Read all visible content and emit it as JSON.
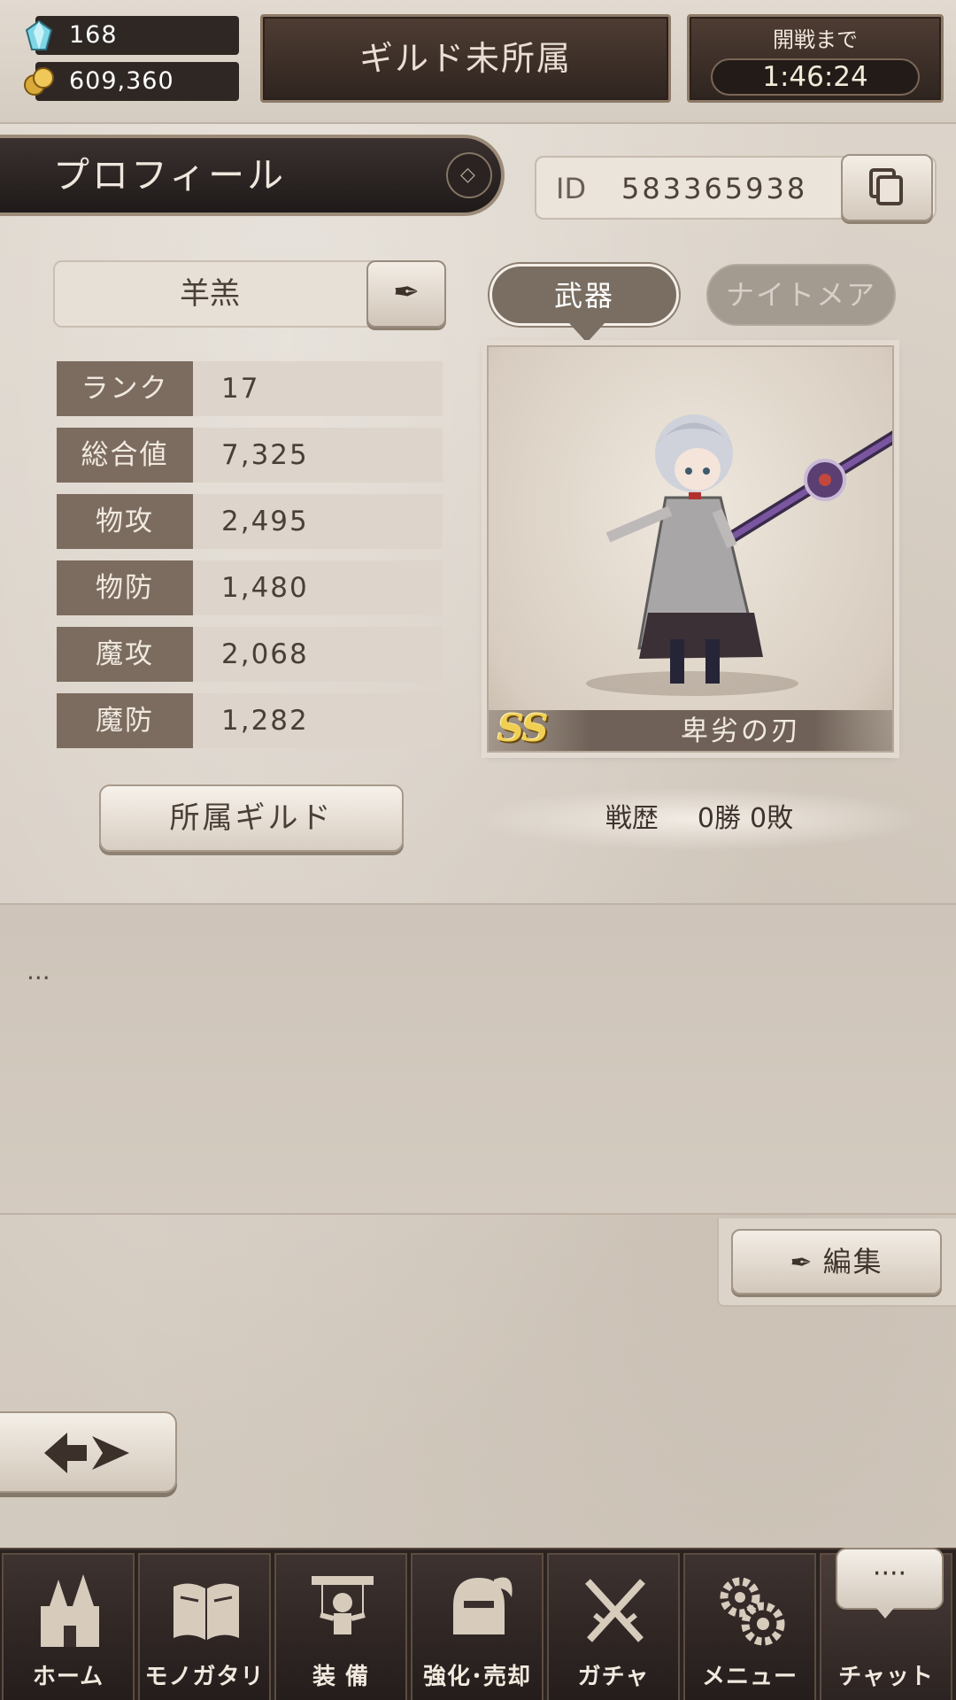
{
  "header": {
    "gems": "168",
    "gold": "609,360",
    "guild_status": "ギルド未所属",
    "battle_label": "開戦まで",
    "battle_timer": "1:46:24"
  },
  "profile": {
    "title": "プロフィール",
    "id_label": "ID",
    "id_value": "583365938",
    "name": "羊羔",
    "stats": [
      {
        "label": "ランク",
        "value": "17"
      },
      {
        "label": "総合値",
        "value": "7,325"
      },
      {
        "label": "物攻",
        "value": "2,495"
      },
      {
        "label": "物防",
        "value": "1,480"
      },
      {
        "label": "魔攻",
        "value": "2,068"
      },
      {
        "label": "魔防",
        "value": "1,282"
      }
    ],
    "guild_button": "所属ギルド"
  },
  "character": {
    "tabs": [
      "武器",
      "ナイトメア"
    ],
    "active_tab": "武器",
    "rarity": "SS",
    "weapon_name": "卑劣の刃",
    "record_label": "戦歴",
    "wins": "0勝",
    "losses": "0敗"
  },
  "comment": {
    "text": "...",
    "edit_button": "編集"
  },
  "nav": {
    "items": [
      {
        "label": "ホーム",
        "icon": "castle-icon"
      },
      {
        "label": "モノガタリ",
        "icon": "book-icon"
      },
      {
        "label": "装 備",
        "icon": "puppet-icon"
      },
      {
        "label": "強化･売却",
        "icon": "helmet-icon"
      },
      {
        "label": "ガチャ",
        "icon": "crossed-swords-icon"
      },
      {
        "label": "メニュー",
        "icon": "gears-icon"
      },
      {
        "label": "チャット",
        "icon": "chat-bubble-icon"
      }
    ],
    "chat_bubble": "····"
  },
  "colors": {
    "accent_dark": "#2e241f",
    "stat_label_bg": "#7c6c5f",
    "rarity_gold": "#f0cf55"
  }
}
